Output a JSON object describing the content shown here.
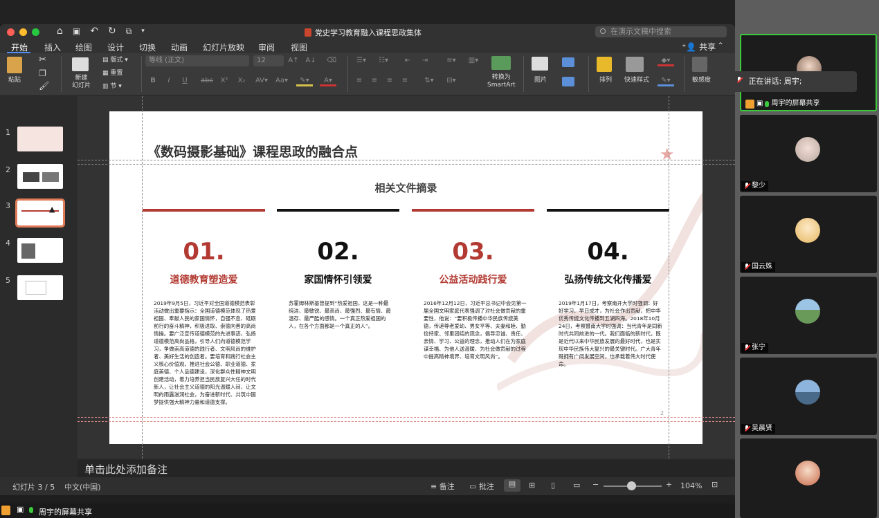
{
  "app": {
    "title": "党史学习教育融入课程思政集体",
    "search_placeholder": "在演示文稿中搜索",
    "share_label": "共享"
  },
  "tabs": [
    "开始",
    "插入",
    "绘图",
    "设计",
    "切换",
    "动画",
    "幻灯片放映",
    "审阅",
    "视图"
  ],
  "ribbon": {
    "paste": "粘贴",
    "new_slide_line1": "新建",
    "new_slide_line2": "幻灯片",
    "layout": "版式",
    "reset": "重置",
    "section": "节",
    "font_name": "等线 (正文)",
    "font_size": "12",
    "convert_line1": "转换为",
    "convert_line2": "SmartArt",
    "picture": "图片",
    "arrange": "排列",
    "quick_styles": "快速样式",
    "sensitivity": "敏感度"
  },
  "thumbnails": [
    "1",
    "2",
    "3",
    "4",
    "5"
  ],
  "slide": {
    "title": "《数码摄影基础》课程思政的融合点",
    "subtitle": "相关文件摘录",
    "page_number": "2",
    "columns": [
      {
        "number": "01.",
        "heading": "道德教育塑造爱",
        "color": "#b23a32",
        "body": "2019年9月5日，习近平对全国道德模范表彰活动做出重要指示：全国道德模范体现了热爱祖国、奉献人民的家国情怀，自强不息、砥砺前行的奋斗精神，积极进取、崇德向善的高尚情操。要广泛宣传道德模范的先进事迹，弘扬道德模范高尚品格，引导人们向道德模范学习，争做崇高道德的践行者、文明风尚的维护者、美好生活的创造者。要培育和践行社会主义核心价值观，推进社会公德、职业道德、家庭美德、个人品德建设，深化群众性精神文明创建活动，着力培养担当民族复兴大任的时代新人，让社会主义道德的阳光温暖人间，让文明的雨露滋润社会，为奋进新时代、共筑中国梦提供强大精神力量和道德支撑。"
      },
      {
        "number": "02.",
        "heading": "家国情怀引领爱",
        "color": "#111111",
        "body": "苏霍姆林斯基曾提到“热爱祖国，这是一种最纯洁、最敏锐、最高尚、最强烈、最有情、最温存、最严酷的感情。一个真正热爱祖国的人，在各个方面都是一个真正的人”。"
      },
      {
        "number": "03.",
        "heading": "公益活动践行爱",
        "color": "#b23a32",
        "body": "2016年12月12日，习近平总书记中会见第一届全国文明家庭代表强调了对社会做贡献的重要性，他说：“要积极传播中华民族传统美德，传递尊老爱幼、男女平等、夫妻和睦、勤俭持家、邻里团结的观念，倡导忠诚、责任、亲情、学习、公益的理念，推动人们在为家庭谋幸福、为他人送温暖、为社会做贡献的过程中提高精神境界、培育文明风尚”。"
      },
      {
        "number": "04.",
        "heading": "弘扬传统文化传播爱",
        "color": "#111111",
        "body": "2019年1月17日，考察南开大学时强调：好好学习、早日成才，为社会作出贡献，把中华优秀传统文化传播到五湖四海。2018年10月24日，考察暨南大学时强调：当代青年是同新时代共同前进的一代。我们面临的新时代，既是近代以来中华民族发展的最好时代，也是实现中华民族伟大复兴的最关键时代。广大青年既拥有广阔发展空间，也承载着伟大时代使命。"
      }
    ]
  },
  "notes_placeholder": "单击此处添加备注",
  "status": {
    "slide_info": "幻灯片 3 / 5",
    "language": "中文(中国)",
    "notes_label": "备注",
    "comments_label": "批注",
    "zoom": "104%"
  },
  "participants": {
    "speaking_label": "正在讲话: 周宇;",
    "tiles": [
      {
        "name": "周宇的屏幕共享"
      },
      {
        "name": "黎少"
      },
      {
        "name": "国云姝"
      },
      {
        "name": "张宁"
      },
      {
        "name": "吴晨贤"
      },
      {
        "name": ""
      }
    ]
  },
  "bottom_share_label": "周宇的屏幕共享"
}
